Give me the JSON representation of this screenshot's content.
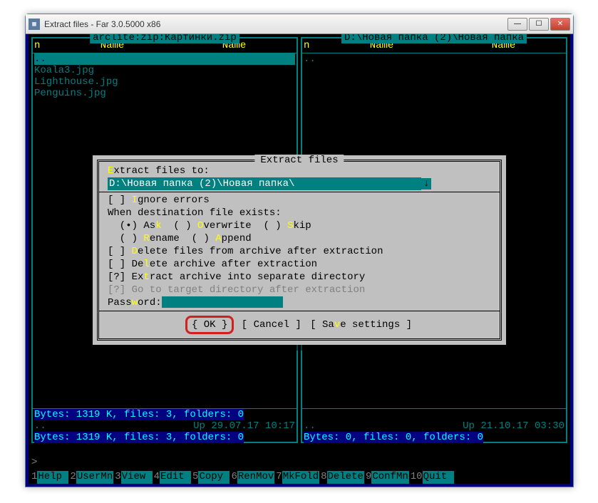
{
  "window": {
    "title": "Extract files - Far 3.0.5000 x86"
  },
  "leftPanel": {
    "title": " arclite:zip:Картинки.zip ",
    "col_n": "n",
    "col_name": "Name",
    "col_name2": "Name",
    "rows": {
      "updir": "..",
      "r1": "Koala3.jpg",
      "r2": "Lighthouse.jpg",
      "r3": "Penguins.jpg"
    },
    "bytes1": " Bytes: 1319 K, files: 3, folders: 0 ",
    "footer_updir": "..",
    "footer_up": "Up",
    "footer_date": "29.07.17 10:17",
    "bytes2": " Bytes: 1319 K, files: 3, folders: 0 "
  },
  "rightPanel": {
    "title": " D:\\Новая папка (2)\\Новая папка ",
    "col_n": "n",
    "col_name": "Name",
    "col_name2": "Name",
    "rows": {
      "updir": ".."
    },
    "footer_updir": "..",
    "footer_up": "Up",
    "footer_date": "21.10.17 03:30",
    "bytes2": " Bytes: 0, files: 0, folders: 0 "
  },
  "cmdline": ">",
  "keybar": {
    "k1n": "1",
    "k1": "Help",
    "k2n": "2",
    "k2": "UserMn",
    "k3n": "3",
    "k3": "View",
    "k4n": "4",
    "k4": "Edit",
    "k5n": "5",
    "k5": "Copy",
    "k6n": "6",
    "k6": "RenMov",
    "k7n": "7",
    "k7": "MkFold",
    "k8n": "8",
    "k8": "Delete",
    "k9n": "9",
    "k9": "ConfMn",
    "k10n": "10",
    "k10": "Quit"
  },
  "dialog": {
    "title": " Extract files ",
    "extract_label_pre": "E",
    "extract_label": "xtract files to:",
    "path": "D:\\Новая папка (2)\\Новая папка\\",
    "arrow": "↓",
    "ignore_pre": "[ ] ",
    "ignore_hl": "I",
    "ignore": "gnore errors",
    "when": "When destination file exists:",
    "ask_pre": "  (•) As",
    "ask_hl": "k",
    "ov_pre": "  ( ) ",
    "ov_hl": "O",
    "ov": "verwrite",
    "skip_pre": "  ( ) ",
    "skip_hl": "S",
    "skip": "kip",
    "ren_pre": "  ( ) ",
    "ren_hl": "R",
    "ren": "ename",
    "app_pre": "  ( ) ",
    "app_hl": "A",
    "app": "ppend",
    "del1_pre": "[ ] ",
    "del1_hl": "D",
    "del1": "elete files from archive after extraction",
    "del2_pre": "[ ] De",
    "del2_hl": "l",
    "del2": "ete archive after extraction",
    "sep_pre": "[?] Ex",
    "sep_hl": "t",
    "sep": "ract archive into separate directory",
    "goto": "[?] Go to target directory after extraction",
    "pass_pre": "Pass",
    "pass_hl": "w",
    "pass": "ord:",
    "btn_ok": "{ OK }",
    "btn_cancel": "[ Cancel ]",
    "btn_save_pre": "[ Sa",
    "btn_save_hl": "v",
    "btn_save": "e settings ]"
  }
}
